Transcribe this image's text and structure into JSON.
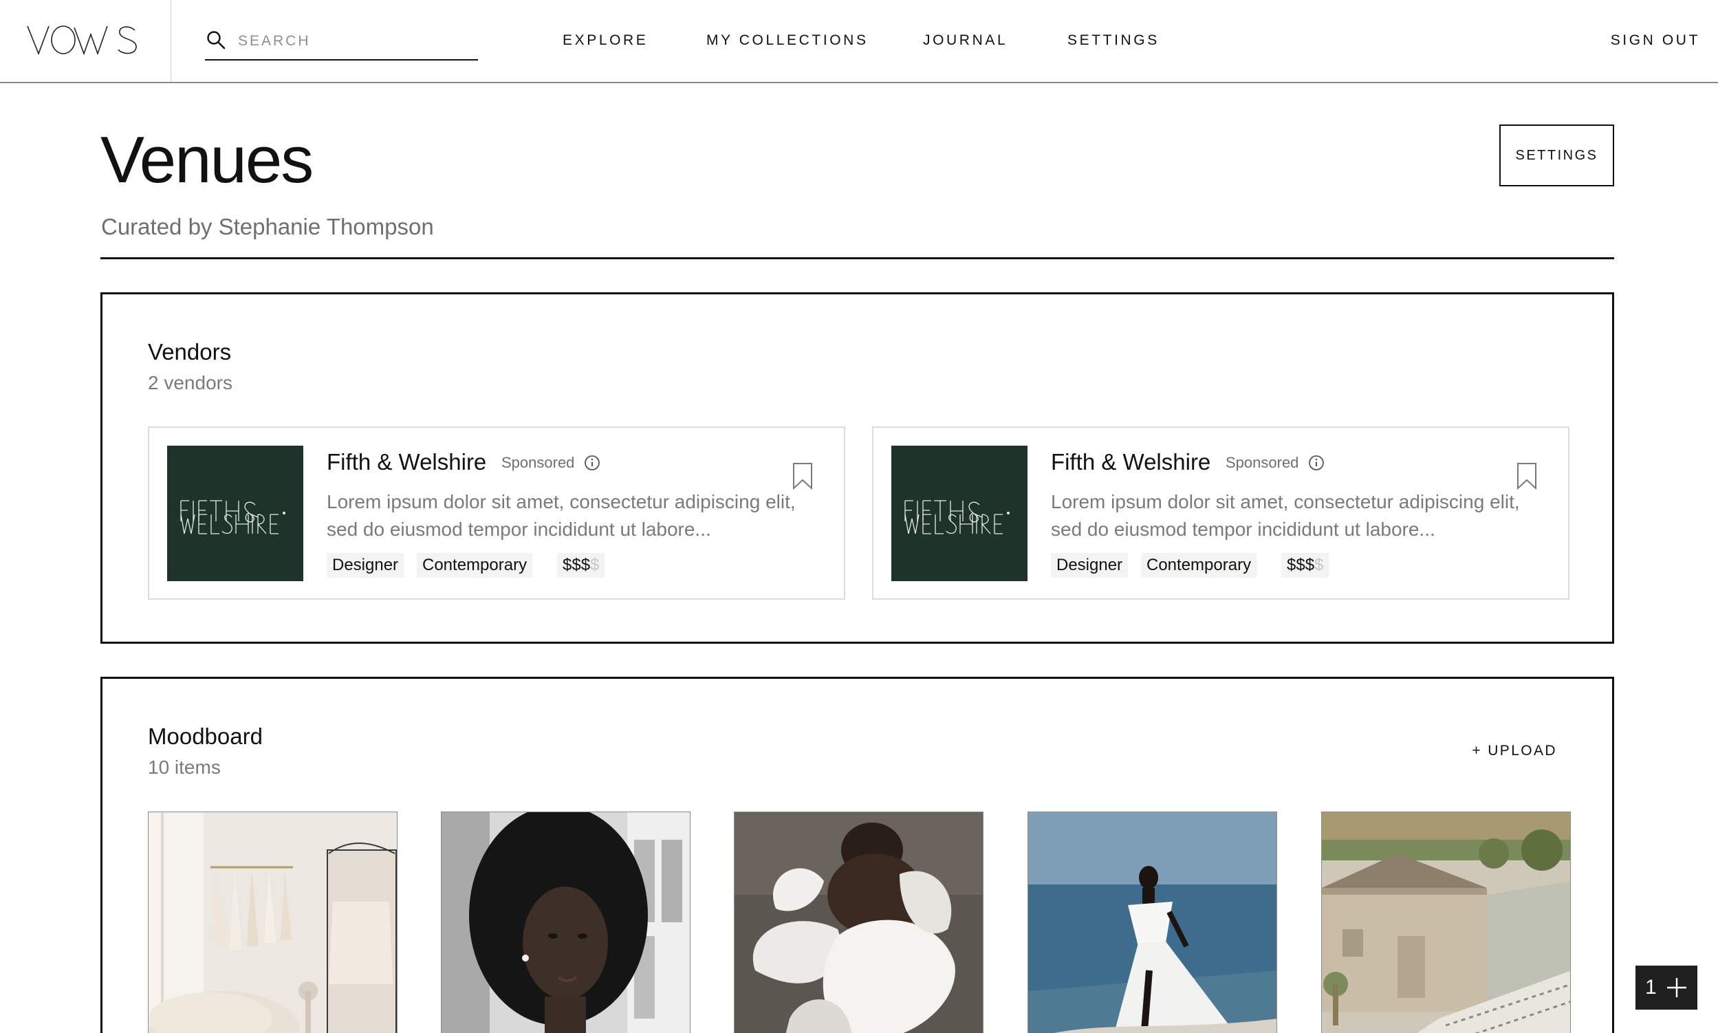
{
  "brand": {
    "logo_text": "VOWS"
  },
  "search": {
    "placeholder": "SEARCH"
  },
  "nav": {
    "explore": "EXPLORE",
    "my_collections": "MY COLLECTIONS",
    "journal": "JOURNAL",
    "settings": "SETTINGS",
    "sign_out": "SIGN OUT"
  },
  "page": {
    "title": "Venues",
    "subtitle": "Curated by Stephanie Thompson",
    "settings_button": "SETTINGS"
  },
  "vendors": {
    "title": "Vendors",
    "count": "2 vendors",
    "items": [
      {
        "name": "Fifth & Welshire",
        "sponsored": "Sponsored",
        "logo_text": "FIFTH & WELSHIRE",
        "description": "Lorem ipsum dolor sit amet, consectetur adipiscing elit, sed do eiusmod tempor incididunt ut labore...",
        "tags": [
          "Designer",
          "Contemporary"
        ],
        "price_active": "$$$",
        "price_inactive": "$"
      },
      {
        "name": "Fifth & Welshire",
        "sponsored": "Sponsored",
        "logo_text": "FIFTH & WELSHIRE",
        "description": "Lorem ipsum dolor sit amet, consectetur adipiscing elit, sed do eiusmod tempor incididunt ut labore...",
        "tags": [
          "Designer",
          "Contemporary"
        ],
        "price_active": "$$$",
        "price_inactive": "$"
      }
    ]
  },
  "moodboard": {
    "title": "Moodboard",
    "count": "10 items",
    "upload": "+ UPLOAD"
  },
  "widget": {
    "count": "1"
  },
  "colors": {
    "text": "#111111",
    "muted": "#7a7a7a",
    "vendor_logo_bg": "#1e3329",
    "tag_bg": "#f3f3f1",
    "widget_bg": "#1f1f1f"
  },
  "icons": {
    "search": "search-icon",
    "info": "info-icon",
    "bookmark": "bookmark-icon",
    "plus": "plus-icon"
  }
}
